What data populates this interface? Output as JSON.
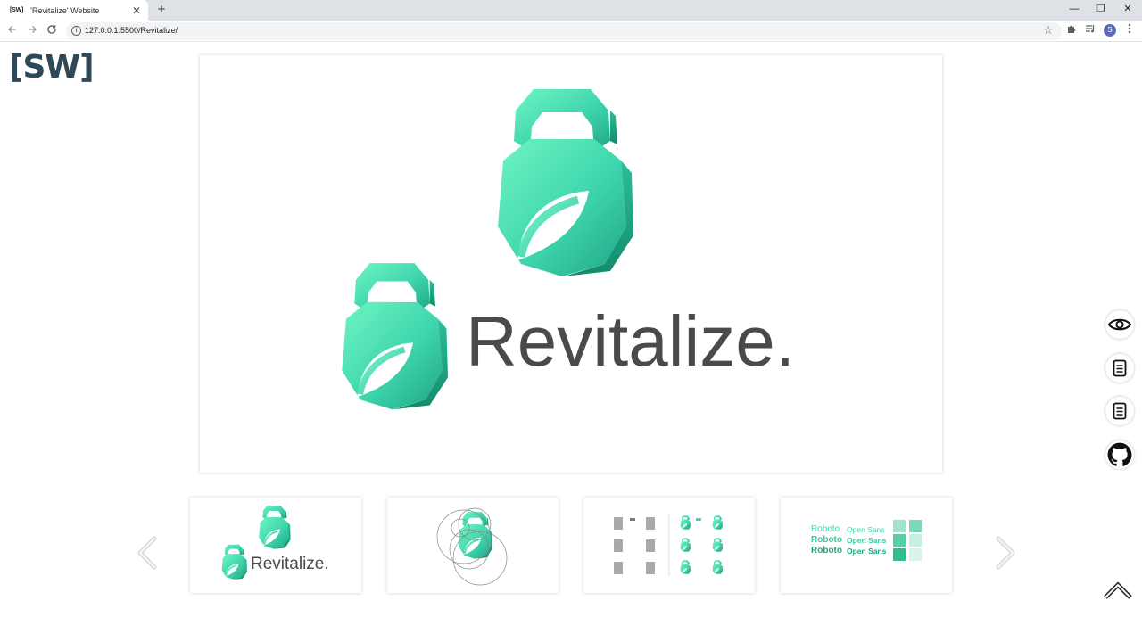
{
  "browser": {
    "tab_favicon": "[SW]",
    "tab_title": "'Revitalize' Website",
    "tab_close": "✕",
    "new_tab": "+",
    "url": "127.0.0.1:5500/Revitalize/",
    "profile_initial": "S",
    "window_controls": {
      "minimize": "—",
      "restore": "❐",
      "close": "✕"
    }
  },
  "page": {
    "site_logo": "[SW]",
    "brand_name": "Revitalize.",
    "thumbnails": [
      {
        "name": "logo-and-wordmark",
        "text": "Revitalize."
      },
      {
        "name": "logo-construction-grid"
      },
      {
        "name": "logo-variations",
        "caption": "Revitalize"
      },
      {
        "name": "typography-and-colors",
        "fonts": [
          "Roboto",
          "Roboto",
          "Roboto"
        ],
        "fonts_alt": [
          "Open Sans",
          "Open Sans",
          "Open Sans"
        ]
      }
    ],
    "side_icons": [
      "eye-icon",
      "document-icon",
      "document-icon",
      "github-icon"
    ],
    "colors": {
      "mint_light": "#6ff5c4",
      "mint_mid": "#3fd6ad",
      "teal_dark": "#1fa584",
      "teal_shadow": "#138a6c",
      "wordmark": "#4a4a4a",
      "sw_logo": "#2f4858",
      "swatches": [
        "#9fe3cc",
        "#7bd9bb",
        "#c6f0e1",
        "#56cfa6",
        "#2fbf8f",
        "#d9f5ea"
      ]
    }
  }
}
